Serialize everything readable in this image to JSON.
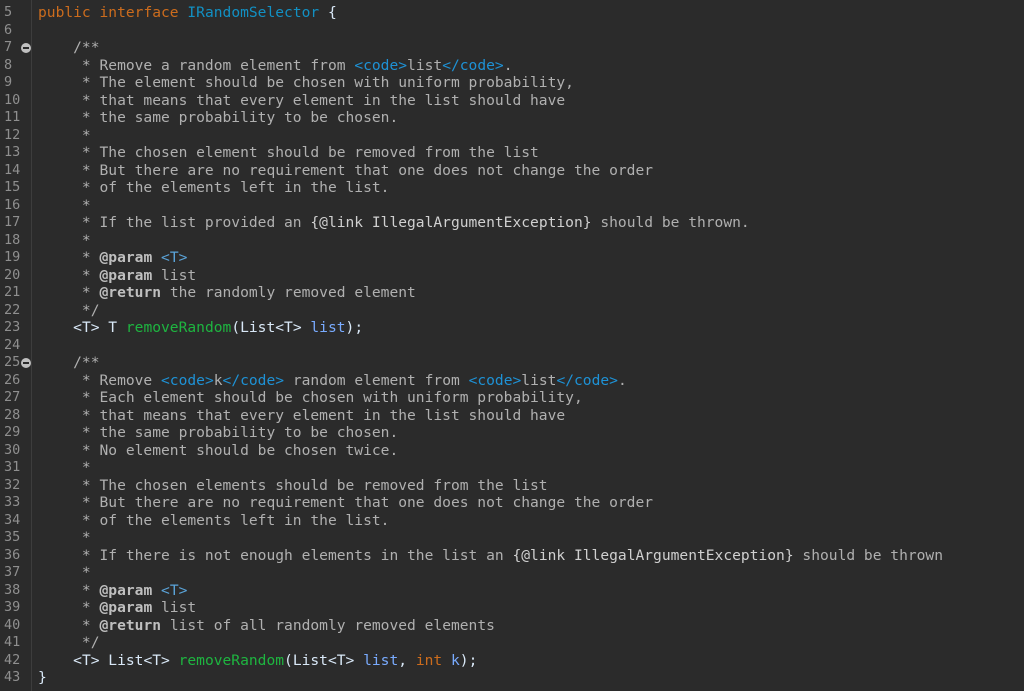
{
  "editor": {
    "gutter": {
      "line_numbers": [
        "5",
        "6",
        "7",
        "8",
        "9",
        "10",
        "11",
        "12",
        "13",
        "14",
        "15",
        "16",
        "17",
        "18",
        "19",
        "20",
        "21",
        "22",
        "23",
        "24",
        "25",
        "26",
        "27",
        "28",
        "29",
        "30",
        "31",
        "32",
        "33",
        "34",
        "35",
        "36",
        "37",
        "38",
        "39",
        "40",
        "41",
        "42",
        "43"
      ],
      "fold_markers": [
        "7",
        "25"
      ]
    },
    "code": {
      "l5": [
        "public",
        " ",
        "interface",
        " ",
        "IRandomSelector",
        " {"
      ],
      "l7": [
        "    /**"
      ],
      "l8": [
        "     * Remove a random element from ",
        "<code>",
        "list",
        "</code>",
        "."
      ],
      "l9": [
        "     * The element should be chosen with uniform probability,"
      ],
      "l10": [
        "     * that means that every element in the list should have"
      ],
      "l11": [
        "     * the same probability to be chosen."
      ],
      "l12": [
        "     *"
      ],
      "l13": [
        "     * The chosen element should be removed from the list"
      ],
      "l14": [
        "     * But there are no requirement that one does not change the order"
      ],
      "l15": [
        "     * of the elements left in the list."
      ],
      "l16": [
        "     *"
      ],
      "l17": [
        "     * If the list provided an ",
        "{@link IllegalArgumentException}",
        " should be thrown."
      ],
      "l18": [
        "     *"
      ],
      "l19": [
        "     * ",
        "@param",
        " ",
        "<T>"
      ],
      "l20": [
        "     * ",
        "@param",
        " list"
      ],
      "l21": [
        "     * ",
        "@return",
        " the randomly removed element"
      ],
      "l22": [
        "     */"
      ],
      "l23": [
        "    ",
        "<T>",
        " T ",
        "removeRandom",
        "(List<T> ",
        "list",
        ");"
      ],
      "l25": [
        "    /**"
      ],
      "l26": [
        "     * Remove ",
        "<code>",
        "k",
        "</code>",
        " random element from ",
        "<code>",
        "list",
        "</code>",
        "."
      ],
      "l27": [
        "     * Each element should be chosen with uniform probability,"
      ],
      "l28": [
        "     * that means that every element in the list should have"
      ],
      "l29": [
        "     * the same probability to be chosen."
      ],
      "l30": [
        "     * No element should be chosen twice."
      ],
      "l31": [
        "     *"
      ],
      "l32": [
        "     * The chosen elements should be removed from the list"
      ],
      "l33": [
        "     * But there are no requirement that one does not change the order"
      ],
      "l34": [
        "     * of the elements left in the list."
      ],
      "l35": [
        "     *"
      ],
      "l36": [
        "     * If there is not enough elements in the list an ",
        "{@link IllegalArgumentException}",
        " should be thrown"
      ],
      "l37": [
        "     *"
      ],
      "l38": [
        "     * ",
        "@param",
        " ",
        "<T>"
      ],
      "l39": [
        "     * ",
        "@param",
        " list"
      ],
      "l40": [
        "     * ",
        "@return",
        " list of all randomly removed elements"
      ],
      "l41": [
        "     */"
      ],
      "l42": [
        "    ",
        "<T>",
        " List<T> ",
        "removeRandom",
        "(List<T> ",
        "list",
        ", ",
        "int",
        " ",
        "k",
        ");"
      ],
      "l43": [
        "}"
      ]
    },
    "colors": {
      "background": "#2b2b2b",
      "keyword": "#cc6c1d",
      "type_name": "#1290c3",
      "comment": "#b0b0b0",
      "html_tag": "#1e92d6",
      "javadoc_tag": "#bfbfbf",
      "method": "#1eb540",
      "variable": "#79abff",
      "line_number": "#8f8f8f"
    }
  }
}
